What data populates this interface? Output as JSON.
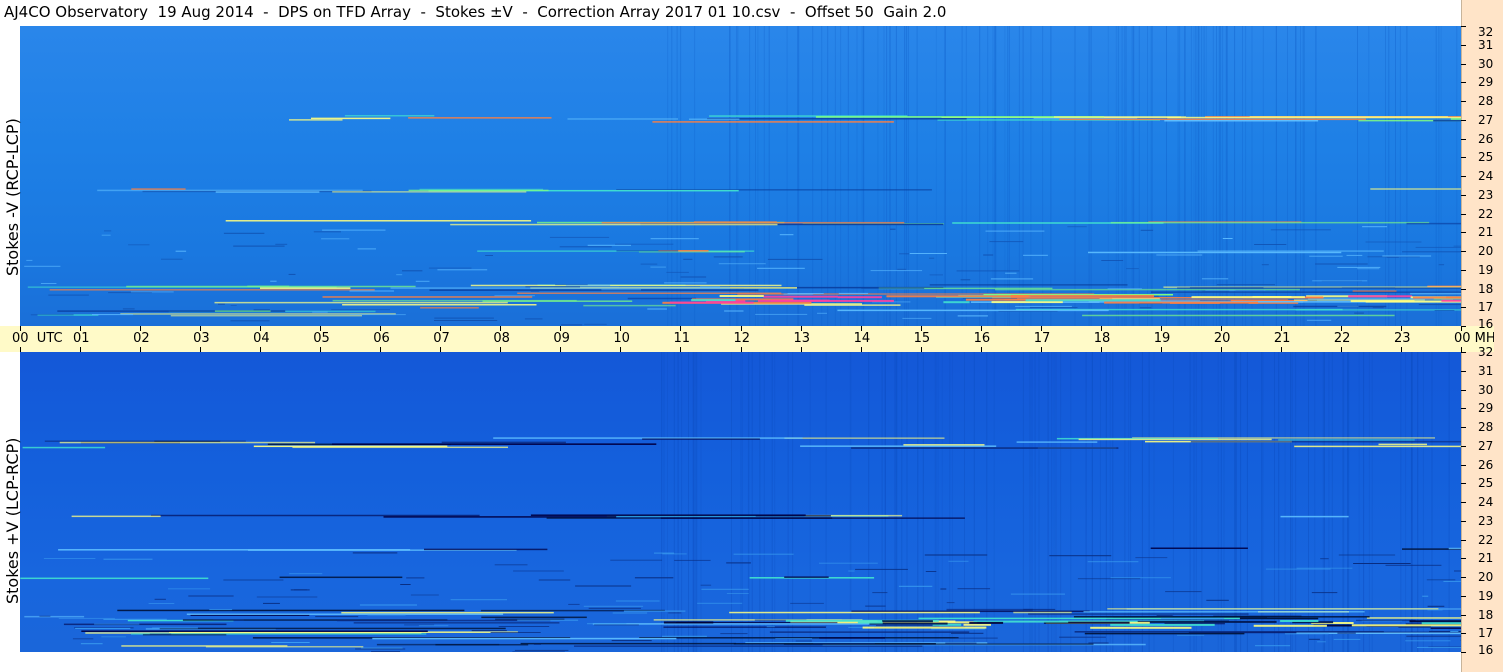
{
  "title": "AJ4CO Observatory  19 Aug 2014  -  DPS on TFD Array  -  Stokes ±V  -  Correction Array 2017 01 10.csv  -  Offset 50  Gain 2.0",
  "panels": [
    {
      "id": "top",
      "ylabel": "Stokes -V (RCP-LCP)",
      "base_color": "#1e7fe6"
    },
    {
      "id": "bottom",
      "ylabel": "Stokes +V (LCP-RCP)",
      "base_color": "#1060d8"
    }
  ],
  "time_axis": {
    "labels": [
      "00  UTC",
      "01",
      "02",
      "03",
      "04",
      "05",
      "06",
      "07",
      "08",
      "09",
      "10",
      "11",
      "12",
      "13",
      "14",
      "15",
      "16",
      "17",
      "18",
      "19",
      "20",
      "21",
      "22",
      "23",
      "00 MHz"
    ]
  },
  "freq_axis": {
    "labels": [
      "32",
      "31",
      "30",
      "29",
      "28",
      "27",
      "26",
      "25",
      "24",
      "23",
      "22",
      "21",
      "20",
      "19",
      "18",
      "17",
      "16"
    ]
  },
  "chart_data": {
    "type": "heatmap",
    "title": "AJ4CO Observatory  19 Aug 2014  -  DPS on TFD Array  -  Stokes ±V  -  Correction Array 2017 01 10.csv  -  Offset 50  Gain 2.0",
    "x_axis": {
      "quantity": "UTC hour",
      "range": [
        0,
        24
      ]
    },
    "y_axis": {
      "quantity": "MHz",
      "range": [
        16,
        32
      ]
    },
    "colorscale": [
      "#000066",
      "#1060d8",
      "#1e90ff",
      "#40e0d0",
      "#ffff80",
      "#ff8040",
      "#ff0000"
    ],
    "panels": [
      "Stokes -V (RCP-LCP)",
      "Stokes +V (LCP-RCP)"
    ]
  }
}
